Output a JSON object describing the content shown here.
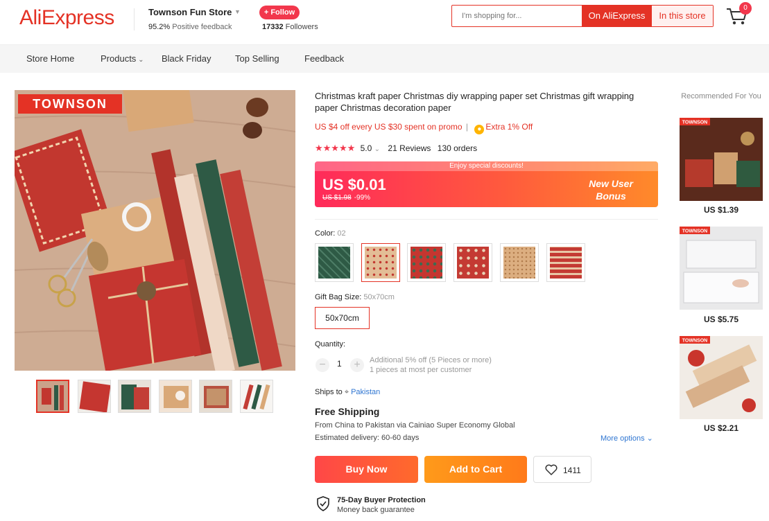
{
  "header": {
    "logo": "AliExpress",
    "store_name": "Townson Fun Store",
    "feedback_pct": "95.2%",
    "feedback_label": "Positive feedback",
    "follow_label": "+ Follow",
    "followers_count": "17332",
    "followers_label": "Followers",
    "search_placeholder": "I'm shopping for...",
    "search_ali_label": "On AliExpress",
    "search_store_label": "In this store",
    "cart_count": "0"
  },
  "nav": {
    "items": [
      "Store Home",
      "Products",
      "Black Friday",
      "Top Selling",
      "Feedback"
    ]
  },
  "gallery": {
    "brand_tag": "TOWNSON"
  },
  "product": {
    "title": "Christmas kraft paper Christmas diy wrapping paper set Christmas gift wrapping paper Christmas decoration paper",
    "promo": "US $4 off every US $30 spent on promo",
    "promo_sep": "|",
    "extra_off": "Extra 1% Off",
    "rating": "5.0",
    "reviews": "21 Reviews",
    "orders": "130 orders",
    "price_banner": "Enjoy special discounts!",
    "price_now": "US $0.01",
    "price_old": "US $1.98",
    "discount": "-99%",
    "new_user_line1": "New User",
    "new_user_line2": "Bonus",
    "color_label": "Color:",
    "color_value": "02",
    "size_label": "Gift Bag Size:",
    "size_value": "50x70cm",
    "size_option": "50x70cm",
    "quantity_label": "Quantity:",
    "quantity": "1",
    "qty_note1": "Additional 5% off (5 Pieces or more)",
    "qty_note2": "1 pieces at most per customer",
    "ships_to_label": "Ships to",
    "ships_to_loc": "Pakistan",
    "shipping_title": "Free Shipping",
    "shipping_from": "From China to Pakistan via Cainiao Super Economy Global",
    "shipping_eta": "Estimated delivery: 60-60 days",
    "more_options": "More options",
    "buy_now": "Buy Now",
    "add_to_cart": "Add to Cart",
    "wishlist_count": "1411",
    "protection_title": "75-Day Buyer Protection",
    "protection_sub": "Money back guarantee"
  },
  "recommended": {
    "title": "Recommended For You",
    "items": [
      {
        "price": "US $1.39",
        "tag": "TOWNSON"
      },
      {
        "price": "US $5.75",
        "tag": "TOWNSON"
      },
      {
        "price": "US $2.21",
        "tag": "TOWNSON"
      }
    ]
  },
  "colors": {
    "accent": "#e43225",
    "link": "#2e75d1"
  }
}
